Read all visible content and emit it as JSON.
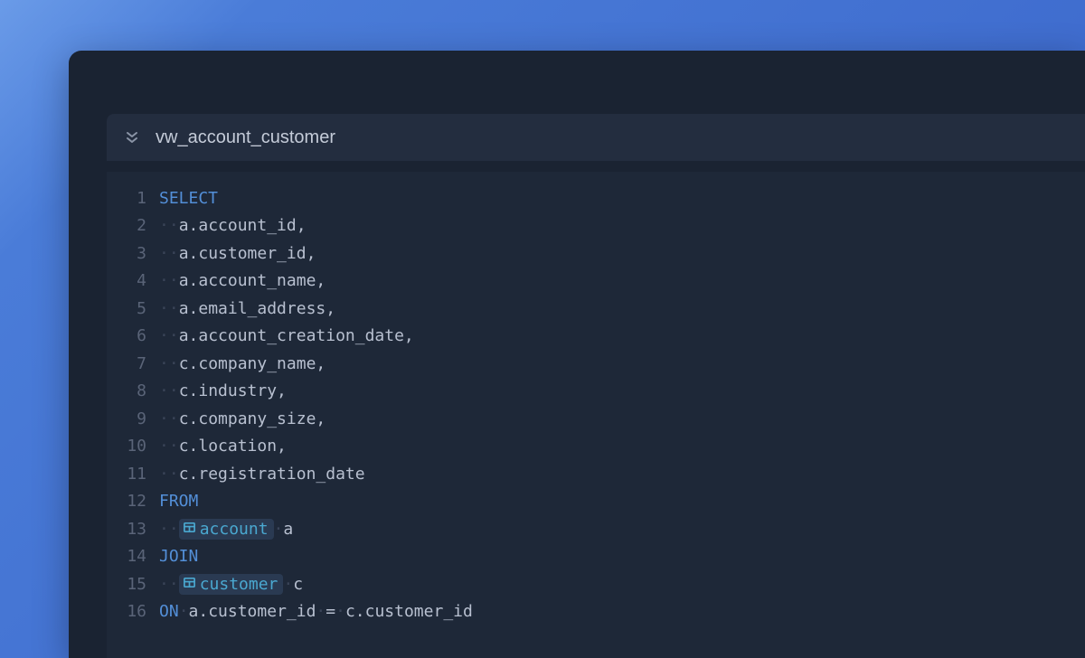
{
  "header": {
    "title": "vw_account_customer"
  },
  "colors": {
    "background_gradient_from": "#6a9be8",
    "background_gradient_to": "#3862c8",
    "window_bg": "#1a2332",
    "header_bg": "#232d3f",
    "editor_bg": "#1e2838",
    "keyword": "#538fd8",
    "text": "#b8c0d0",
    "gutter": "#5a6478",
    "table_ref_bg": "#2a3a52",
    "table_ref_fg": "#4aa8d0"
  },
  "editor": {
    "lines": [
      {
        "n": 1,
        "tokens": [
          {
            "t": "kw",
            "v": "SELECT"
          }
        ]
      },
      {
        "n": 2,
        "tokens": [
          {
            "t": "ws",
            "v": "··"
          },
          {
            "t": "txt",
            "v": "a.account_id,"
          }
        ]
      },
      {
        "n": 3,
        "tokens": [
          {
            "t": "ws",
            "v": "··"
          },
          {
            "t": "txt",
            "v": "a.customer_id,"
          }
        ]
      },
      {
        "n": 4,
        "tokens": [
          {
            "t": "ws",
            "v": "··"
          },
          {
            "t": "txt",
            "v": "a.account_name,"
          }
        ]
      },
      {
        "n": 5,
        "tokens": [
          {
            "t": "ws",
            "v": "··"
          },
          {
            "t": "txt",
            "v": "a.email_address,"
          }
        ]
      },
      {
        "n": 6,
        "tokens": [
          {
            "t": "ws",
            "v": "··"
          },
          {
            "t": "txt",
            "v": "a.account_creation_date,"
          }
        ]
      },
      {
        "n": 7,
        "tokens": [
          {
            "t": "ws",
            "v": "··"
          },
          {
            "t": "txt",
            "v": "c.company_name,"
          }
        ]
      },
      {
        "n": 8,
        "tokens": [
          {
            "t": "ws",
            "v": "··"
          },
          {
            "t": "txt",
            "v": "c.industry,"
          }
        ]
      },
      {
        "n": 9,
        "tokens": [
          {
            "t": "ws",
            "v": "··"
          },
          {
            "t": "txt",
            "v": "c.company_size,"
          }
        ]
      },
      {
        "n": 10,
        "tokens": [
          {
            "t": "ws",
            "v": "··"
          },
          {
            "t": "txt",
            "v": "c.location,"
          }
        ]
      },
      {
        "n": 11,
        "tokens": [
          {
            "t": "ws",
            "v": "··"
          },
          {
            "t": "txt",
            "v": "c.registration_date"
          }
        ]
      },
      {
        "n": 12,
        "tokens": [
          {
            "t": "kw",
            "v": "FROM"
          }
        ]
      },
      {
        "n": 13,
        "tokens": [
          {
            "t": "ws",
            "v": "··"
          },
          {
            "t": "tbl",
            "v": "account"
          },
          {
            "t": "ws",
            "v": "·"
          },
          {
            "t": "txt",
            "v": "a"
          }
        ]
      },
      {
        "n": 14,
        "tokens": [
          {
            "t": "kw",
            "v": "JOIN"
          }
        ]
      },
      {
        "n": 15,
        "tokens": [
          {
            "t": "ws",
            "v": "··"
          },
          {
            "t": "tbl",
            "v": "customer"
          },
          {
            "t": "ws",
            "v": "·"
          },
          {
            "t": "txt",
            "v": "c"
          }
        ]
      },
      {
        "n": 16,
        "tokens": [
          {
            "t": "kw",
            "v": "ON"
          },
          {
            "t": "ws",
            "v": "·"
          },
          {
            "t": "txt",
            "v": "a.customer_id"
          },
          {
            "t": "ws",
            "v": "·"
          },
          {
            "t": "txt",
            "v": "="
          },
          {
            "t": "ws",
            "v": "·"
          },
          {
            "t": "txt",
            "v": "c.customer_id"
          }
        ]
      }
    ]
  }
}
